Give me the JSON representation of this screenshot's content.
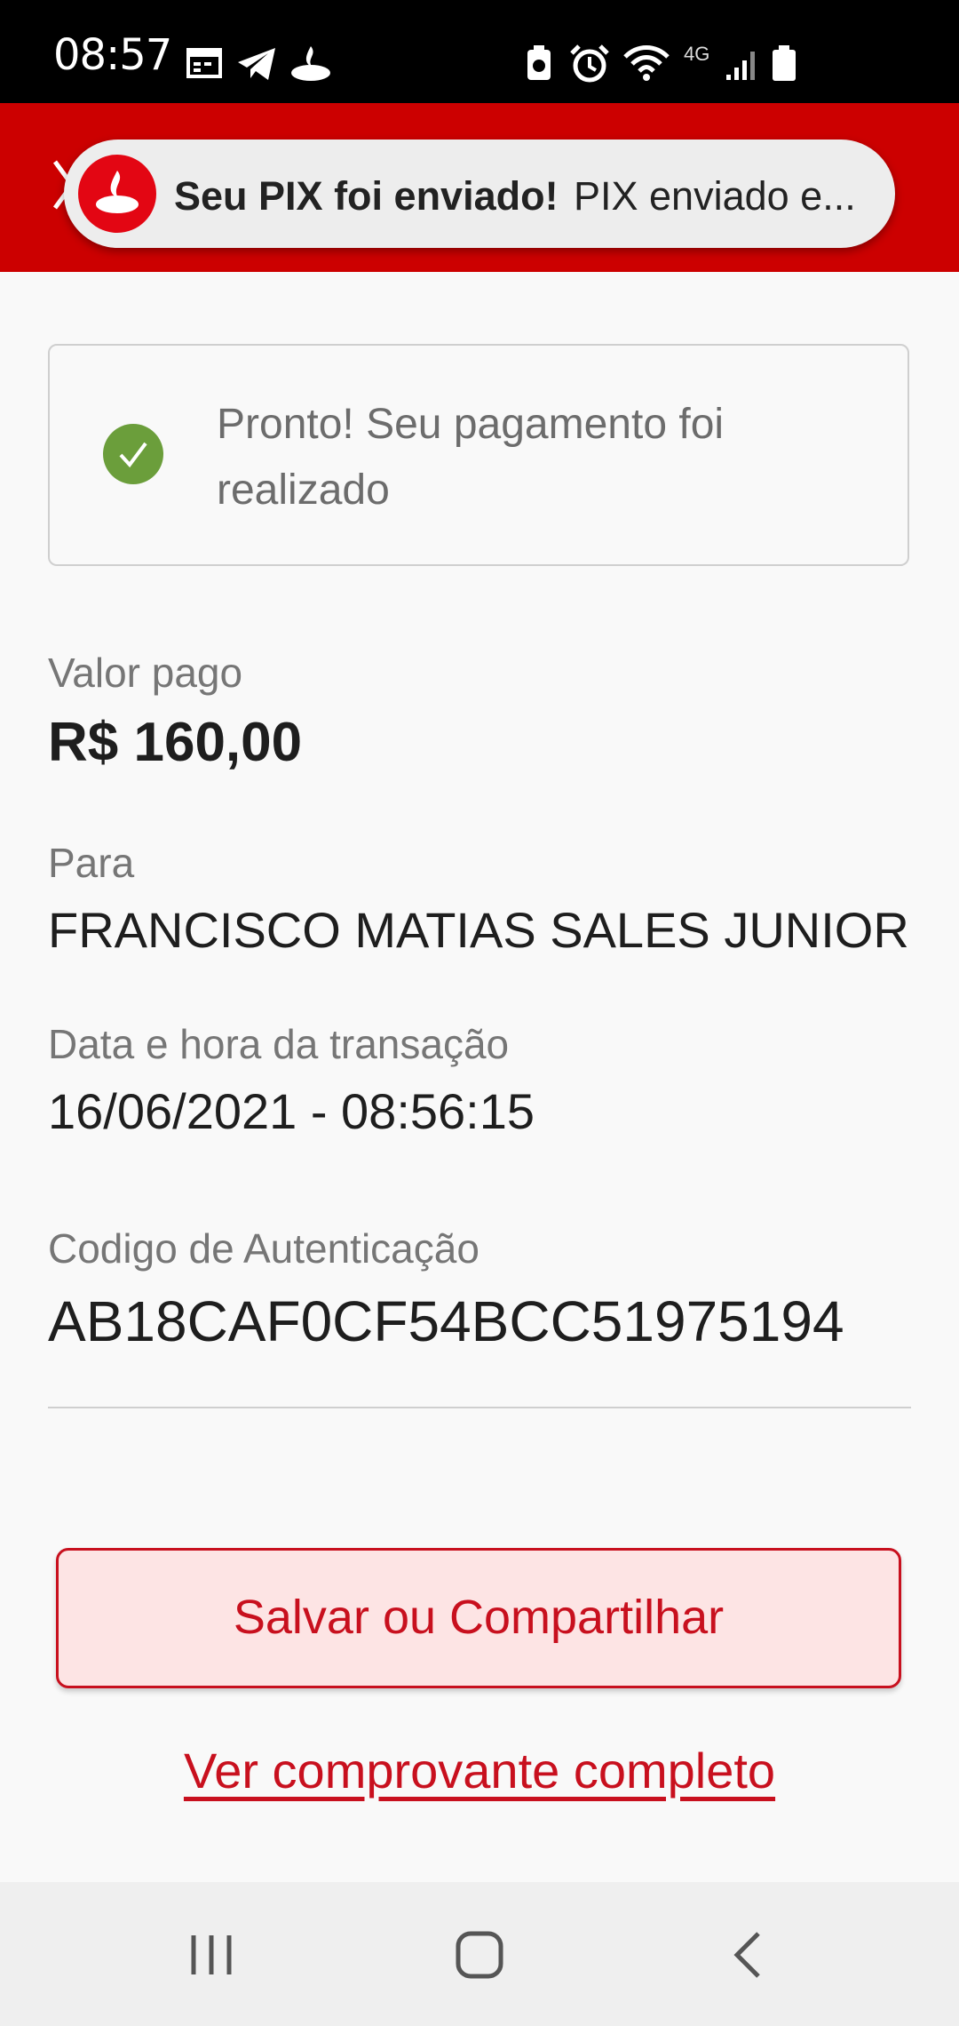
{
  "status_bar": {
    "time": "08:57",
    "network": "4G",
    "icons": [
      "calendar-icon",
      "telegram-icon",
      "santander-icon",
      "battery-saver-icon",
      "alarm-icon",
      "wifi-icon",
      "signal-icon",
      "battery-icon"
    ]
  },
  "notification": {
    "title": "Seu PIX foi enviado!",
    "body": "PIX enviado e..."
  },
  "success": {
    "message": "Pronto! Seu pagamento foi realizado"
  },
  "details": {
    "amount_label": "Valor pago",
    "amount": "R$ 160,00",
    "recipient_label": "Para",
    "recipient": "FRANCISCO MATIAS SALES JUNIOR",
    "datetime_label": "Data e hora da transação",
    "datetime": "16/06/2021 - 08:56:15",
    "auth_label": "Codigo de Autenticação",
    "auth_code": "AB18CAF0CF54BCC51975194"
  },
  "actions": {
    "share_label": "Salvar ou Compartilhar",
    "full_receipt_label": "Ver comprovante completo"
  },
  "colors": {
    "brand_red": "#cc0000",
    "accent_red": "#c8101e",
    "success_green": "#6b9e3b"
  }
}
